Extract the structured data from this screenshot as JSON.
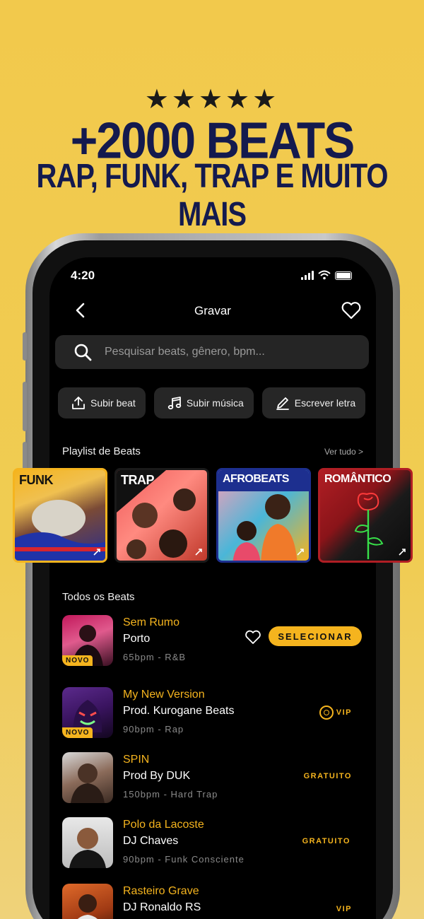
{
  "promo": {
    "stars": "★★★★★",
    "headline": "+2000 BEATS",
    "subline": "RAP, FUNK, TRAP E MUITO MAIS"
  },
  "status": {
    "time": "4:20"
  },
  "nav": {
    "title": "Gravar",
    "back_icon": "chevron-left-icon",
    "fav_icon": "heart-icon"
  },
  "search": {
    "placeholder": "Pesquisar beats, gênero, bpm...",
    "value": ""
  },
  "actions": [
    {
      "label": "Subir beat",
      "icon": "upload-icon"
    },
    {
      "label": "Subir música",
      "icon": "music-note-icon"
    },
    {
      "label": "Escrever letra",
      "icon": "pencil-icon"
    }
  ],
  "playlist": {
    "title": "Playlist de Beats",
    "more": "Ver tudo >",
    "cards": [
      {
        "label": "FUNK",
        "border": "#f5b41e"
      },
      {
        "label": "TRAP",
        "border": "#1a1a1a"
      },
      {
        "label": "AFROBEATS",
        "border": "#1d2f8f"
      },
      {
        "label": "ROMÂNTICO",
        "border": "#b01e24"
      }
    ]
  },
  "all_beats": {
    "title": "Todos os Beats",
    "rows": [
      {
        "title": "Sem Rumo",
        "artist": "Porto",
        "meta": "65bpm - R&B",
        "badge": "NOVO",
        "action": "SELECIONAR"
      },
      {
        "title": "My New Version",
        "artist": "Prod. Kurogane Beats",
        "meta": "90bpm - Rap",
        "badge": "NOVO",
        "tag": "VIP"
      },
      {
        "title": "SPIN",
        "artist": "Prod By DUK",
        "meta": "150bpm - Hard Trap",
        "tag": "GRATUITO"
      },
      {
        "title": "Polo da Lacoste",
        "artist": "DJ Chaves",
        "meta": "90bpm - Funk Consciente",
        "tag": "GRATUITO"
      },
      {
        "title": "Rasteiro Grave",
        "artist": "DJ Ronaldo RS",
        "meta": "",
        "tag": "VIP"
      }
    ]
  },
  "colors": {
    "accent": "#f5b41e",
    "background": "#f2c94c",
    "headline": "#141a4e"
  }
}
